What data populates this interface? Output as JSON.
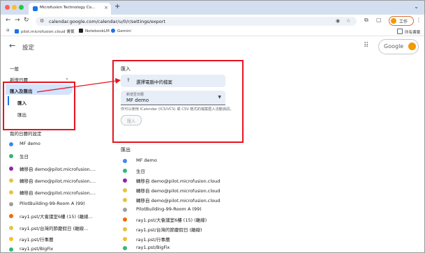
{
  "browser": {
    "tab_title": "Microfusion Technology Co...",
    "url": "calendar.google.com/calendar/u/0/r/settings/export",
    "profile_label": "工作",
    "bookmarks": [
      {
        "label": "pilot.microfusion.cloud 書籤",
        "color": "#1a73e8"
      },
      {
        "label": "NotebookLM",
        "color": "#202124"
      },
      {
        "label": "Gemini",
        "color": "#1a73e8"
      }
    ],
    "all_bookmarks": "所有書籤"
  },
  "header": {
    "title": "設定",
    "brand": "Google"
  },
  "sidebar": {
    "general": "一般",
    "add_calendar": "新增日曆",
    "import_export": "匯入及匯出",
    "sub_import": "匯入",
    "sub_export": "匯出",
    "my_settings": "我的日曆的設定",
    "calendars": [
      {
        "name": "MF demo",
        "color": "#4285f4"
      },
      {
        "name": "生日",
        "color": "#33b679"
      },
      {
        "name": "轉移自 demo@pilot.microfusion....",
        "color": "#8e24aa"
      },
      {
        "name": "轉移自 demo@pilot.microfusion....",
        "color": "#e4c441"
      },
      {
        "name": "轉移自 demo@pilot.microfusion....",
        "color": "#e4c441"
      },
      {
        "name": "PilotBuilding-99-Room A (99)",
        "color": "#9e9e9e"
      },
      {
        "name": "ray1.pst/大會議室6樓 (15) (離線...",
        "color": "#ef6c00"
      },
      {
        "name": "ray1.pst/台灣的節慶假日 (離線...",
        "color": "#e4c441"
      },
      {
        "name": "ray1.pst/行事曆",
        "color": "#f6bf26"
      },
      {
        "name": "ray1.pst/BigFix",
        "color": "#33b679"
      }
    ]
  },
  "import_section": {
    "title": "匯入",
    "select_file": "選擇電腦中的檔案",
    "target_label": "新增至日曆",
    "target_value": "MF demo",
    "hint": "你可以使用 iCalendar (ICS/VCS) 或 CSV 格式的檔案匯入活動資訊。",
    "import_button": "匯入"
  },
  "export_section": {
    "title": "匯出",
    "calendars": [
      {
        "name": "MF demo",
        "color": "#4285f4"
      },
      {
        "name": "生日",
        "color": "#33b679"
      },
      {
        "name": "轉移自 demo@pilot.microfusion.cloud",
        "color": "#8e24aa"
      },
      {
        "name": "轉移自 demo@pilot.microfusion.cloud",
        "color": "#e4c441"
      },
      {
        "name": "轉移自 demo@pilot.microfusion.cloud",
        "color": "#e4c441"
      },
      {
        "name": "PilotBuilding-99-Room A (99)",
        "color": "#9e9e9e"
      },
      {
        "name": "ray1.pst/大會議室6樓 (15) (離線)",
        "color": "#ef6c00"
      },
      {
        "name": "ray1.pst/台灣的節慶假日 (離線)",
        "color": "#e4c441"
      },
      {
        "name": "ray1.pst/行事曆",
        "color": "#f6bf26"
      },
      {
        "name": "ray1.pst/BigFix",
        "color": "#33b679"
      }
    ]
  },
  "colors": {
    "annotation_red": "#e5141f",
    "selected_bg": "#d3e3fd",
    "accent_blue": "#1a73e8"
  }
}
